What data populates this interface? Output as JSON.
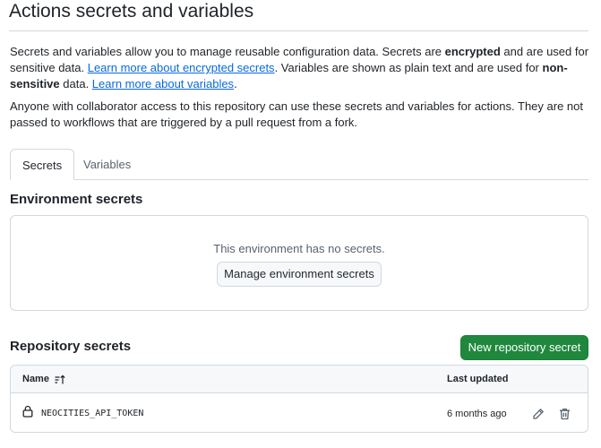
{
  "page": {
    "title": "Actions secrets and variables"
  },
  "intro": {
    "p1_a": "Secrets and variables allow you to manage reusable configuration data. Secrets are ",
    "p1_b": "encrypted",
    "p1_c": " and are used for sensitive data. ",
    "p1_link1": "Learn more about encrypted secrets",
    "p1_d": ". Variables are shown as plain text and are used for ",
    "p1_e": "non-sensitive",
    "p1_f": " data. ",
    "p1_link2": "Learn more about variables",
    "p1_g": ".",
    "p2": "Anyone with collaborator access to this repository can use these secrets and variables for actions. They are not passed to workflows that are triggered by a pull request from a fork."
  },
  "tabs": [
    {
      "label": "Secrets",
      "active": true
    },
    {
      "label": "Variables",
      "active": false
    }
  ],
  "environment": {
    "heading": "Environment secrets",
    "empty_text": "This environment has no secrets.",
    "manage_label": "Manage environment secrets"
  },
  "repository": {
    "heading": "Repository secrets",
    "new_label": "New repository secret",
    "columns": {
      "name": "Name",
      "updated": "Last updated"
    },
    "rows": [
      {
        "name": "NEOCITIES_API_TOKEN",
        "updated": "6 months ago"
      }
    ]
  },
  "icons": {
    "sort": "sort-ascending-icon",
    "lock": "lock-icon",
    "edit": "pencil-icon",
    "delete": "trash-icon"
  },
  "colors": {
    "link": "#0969da",
    "primary_button": "#1f883d",
    "border": "#d1d9e0",
    "muted_text": "#59636e"
  }
}
